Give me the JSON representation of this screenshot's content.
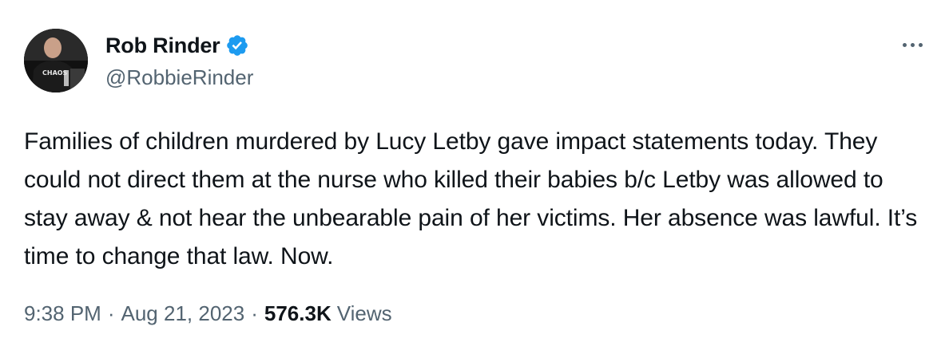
{
  "author": {
    "display_name": "Rob Rinder",
    "handle": "@RobbieRinder",
    "verified": true,
    "avatar_shirt_text": "CHAOS"
  },
  "tweet": {
    "text": "Families of children murdered by Lucy Letby gave impact statements today. They could not direct them at the nurse who killed their babies b/c Letby was allowed to stay away & not hear the unbearable pain of her victims. Her absence was lawful. It’s time to change that law. Now.",
    "time": "9:38 PM",
    "date": "Aug 21, 2023",
    "separator": "·",
    "views_count": "576.3K",
    "views_label": "Views"
  },
  "menu": {
    "more_icon": "more-horizontal-icon"
  },
  "colors": {
    "text_primary": "#0f1419",
    "text_secondary": "#536471",
    "verified_blue": "#1d9bf0"
  }
}
